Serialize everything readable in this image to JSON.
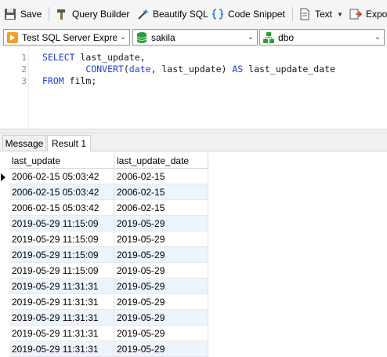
{
  "toolbar": {
    "save_label": "Save",
    "query_builder_label": "Query Builder",
    "beautify_label": "Beautify SQL",
    "snippet_label": "Code Snippet",
    "text_label": "Text",
    "export_label": "Expor"
  },
  "selectors": {
    "connection": "Test SQL Server Expres",
    "database": "sakila",
    "schema": "dbo"
  },
  "editor": {
    "line_numbers": [
      "1",
      "2",
      "3"
    ]
  },
  "tabs": {
    "message_label": "Message",
    "result_label": "Result 1"
  },
  "grid": {
    "columns": [
      "last_update",
      "last_update_date"
    ],
    "rows": [
      [
        "2006-02-15 05:03:42",
        "2006-02-15"
      ],
      [
        "2006-02-15 05:03:42",
        "2006-02-15"
      ],
      [
        "2006-02-15 05:03:42",
        "2006-02-15"
      ],
      [
        "2019-05-29 11:15:09",
        "2019-05-29"
      ],
      [
        "2019-05-29 11:15:09",
        "2019-05-29"
      ],
      [
        "2019-05-29 11:15:09",
        "2019-05-29"
      ],
      [
        "2019-05-29 11:15:09",
        "2019-05-29"
      ],
      [
        "2019-05-29 11:31:31",
        "2019-05-29"
      ],
      [
        "2019-05-29 11:31:31",
        "2019-05-29"
      ],
      [
        "2019-05-29 11:31:31",
        "2019-05-29"
      ],
      [
        "2019-05-29 11:31:31",
        "2019-05-29"
      ],
      [
        "2019-05-29 11:31:31",
        "2019-05-29"
      ]
    ]
  },
  "colors": {
    "keyword": "#1c3fd6",
    "row_alt": "#eef4fb",
    "db_icon": "#2e9b3a"
  }
}
